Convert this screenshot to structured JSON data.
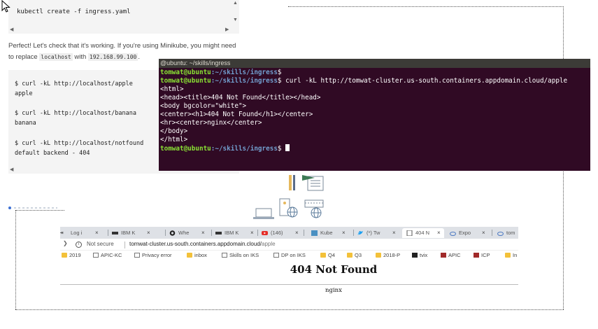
{
  "code_block_1": {
    "command": "kubectl create -f ingress.yaml"
  },
  "paragraph": {
    "text_before": "Perfect! Let's check that it's working. If you're using Minikube, you might need to replace ",
    "code_a": "localhost",
    "text_middle": " with ",
    "code_b": "192.168.99.100",
    "text_after": "."
  },
  "code_block_2": {
    "lines": [
      "$ curl -kL http://localhost/apple",
      "apple",
      "$ curl -kL http://localhost/banana",
      "banana",
      "$ curl -kL http://localhost/notfound",
      "default backend - 404"
    ]
  },
  "terminal": {
    "title": "@ubuntu: ~/skills/ingress",
    "prompt_user": "tomwat@ubuntu",
    "prompt_path": ":~/skills/ingress",
    "prompt_symbol": "$",
    "command": " curl -kL http://tomwat-cluster.us-south.containers.appdomain.cloud/apple",
    "output": [
      "<html>",
      "<head><title>404 Not Found</title></head>",
      "<body bgcolor=\"white\">",
      "<center><h1>404 Not Found</h1></center>",
      "<hr><center>nginx</center>",
      "</body>",
      "</html>"
    ]
  },
  "browser": {
    "tabs": [
      {
        "label": "Log i",
        "icon": "login-icon"
      },
      {
        "label": "IBM K",
        "icon": "ibm-icon"
      },
      {
        "label": "Whe",
        "icon": "github-icon"
      },
      {
        "label": "IBM K",
        "icon": "ibm-icon"
      },
      {
        "label": "(146)",
        "icon": "youtube-icon"
      },
      {
        "label": "Kube",
        "icon": "kube-icon"
      },
      {
        "label": "(*) Tw",
        "icon": "twitter-icon"
      },
      {
        "label": "404 N",
        "icon": "page-icon"
      },
      {
        "label": "Expo",
        "icon": "cloud-icon"
      },
      {
        "label": "tom",
        "icon": "cloud-icon"
      }
    ],
    "security_label": "Not secure",
    "url_host": "tomwat-cluster.us-south.containers.appdomain.cloud/",
    "url_path": "apple",
    "bookmarks": [
      {
        "label": "2019",
        "kind": "folder"
      },
      {
        "label": "APIC-KC",
        "kind": "page"
      },
      {
        "label": "Privacy error",
        "kind": "page"
      },
      {
        "label": "inbox",
        "kind": "folder"
      },
      {
        "label": "Skills on IKS",
        "kind": "page"
      },
      {
        "label": "DP on IKS",
        "kind": "page"
      },
      {
        "label": "Q4",
        "kind": "folder"
      },
      {
        "label": "Q3",
        "kind": "folder"
      },
      {
        "label": "2018-P",
        "kind": "folder"
      },
      {
        "label": "tvix",
        "kind": "dark"
      },
      {
        "label": "APIC",
        "kind": "red"
      },
      {
        "label": "ICP",
        "kind": "red"
      },
      {
        "label": "In",
        "kind": "folder"
      }
    ],
    "page_heading": "404 Not Found",
    "page_footer": "nginx"
  },
  "colors": {
    "terminal_bg": "#300a24",
    "prompt_user": "#8ae234",
    "prompt_path": "#729fcf",
    "folder": "#f3c13a"
  }
}
